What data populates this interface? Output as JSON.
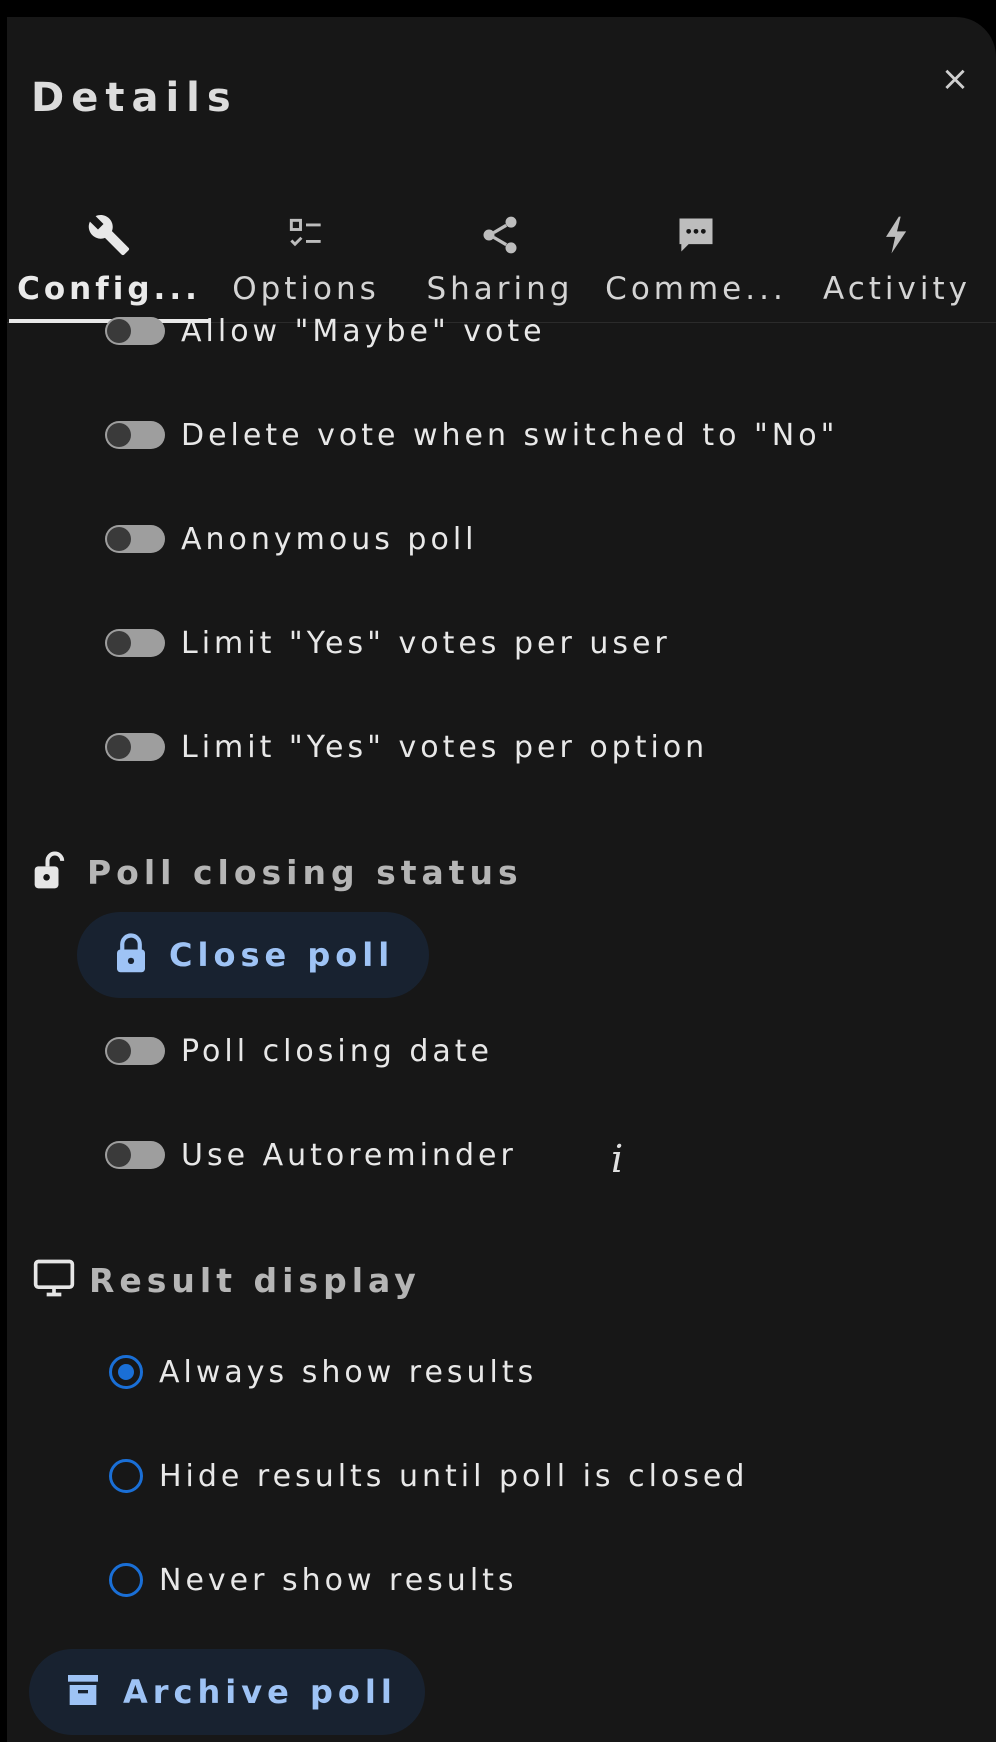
{
  "panel": {
    "title": "Details",
    "close_label": "×"
  },
  "tabs": [
    {
      "label": "Config...",
      "icon": "wrench-icon",
      "active": true
    },
    {
      "label": "Options",
      "icon": "checklist-icon",
      "active": false
    },
    {
      "label": "Sharing",
      "icon": "share-icon",
      "active": false
    },
    {
      "label": "Comme...",
      "icon": "comment-icon",
      "active": false
    },
    {
      "label": "Activity",
      "icon": "lightning-icon",
      "active": false
    }
  ],
  "toggles": [
    {
      "label": "Allow \"Maybe\" vote",
      "on": false
    },
    {
      "label": "Delete vote when switched to \"No\"",
      "on": false
    },
    {
      "label": "Anonymous poll",
      "on": false
    },
    {
      "label": "Limit \"Yes\" votes per user",
      "on": false
    },
    {
      "label": "Limit \"Yes\" votes per option",
      "on": false
    }
  ],
  "closing": {
    "section_label": "Poll closing status",
    "close_button": "Close poll",
    "date_toggle": "Poll closing date",
    "reminder_toggle": "Use Autoreminder",
    "info_glyph": "i"
  },
  "result_display": {
    "section_label": "Result display",
    "options": [
      {
        "label": "Always show results",
        "selected": true
      },
      {
        "label": "Hide results until poll is closed",
        "selected": false
      },
      {
        "label": "Never show results",
        "selected": false
      }
    ]
  },
  "archive_button": "Archive poll",
  "colors": {
    "accent": "#1a6fd6",
    "pill_bg": "#182230",
    "pill_text": "#9ec3f5",
    "panel_bg": "#171717"
  }
}
